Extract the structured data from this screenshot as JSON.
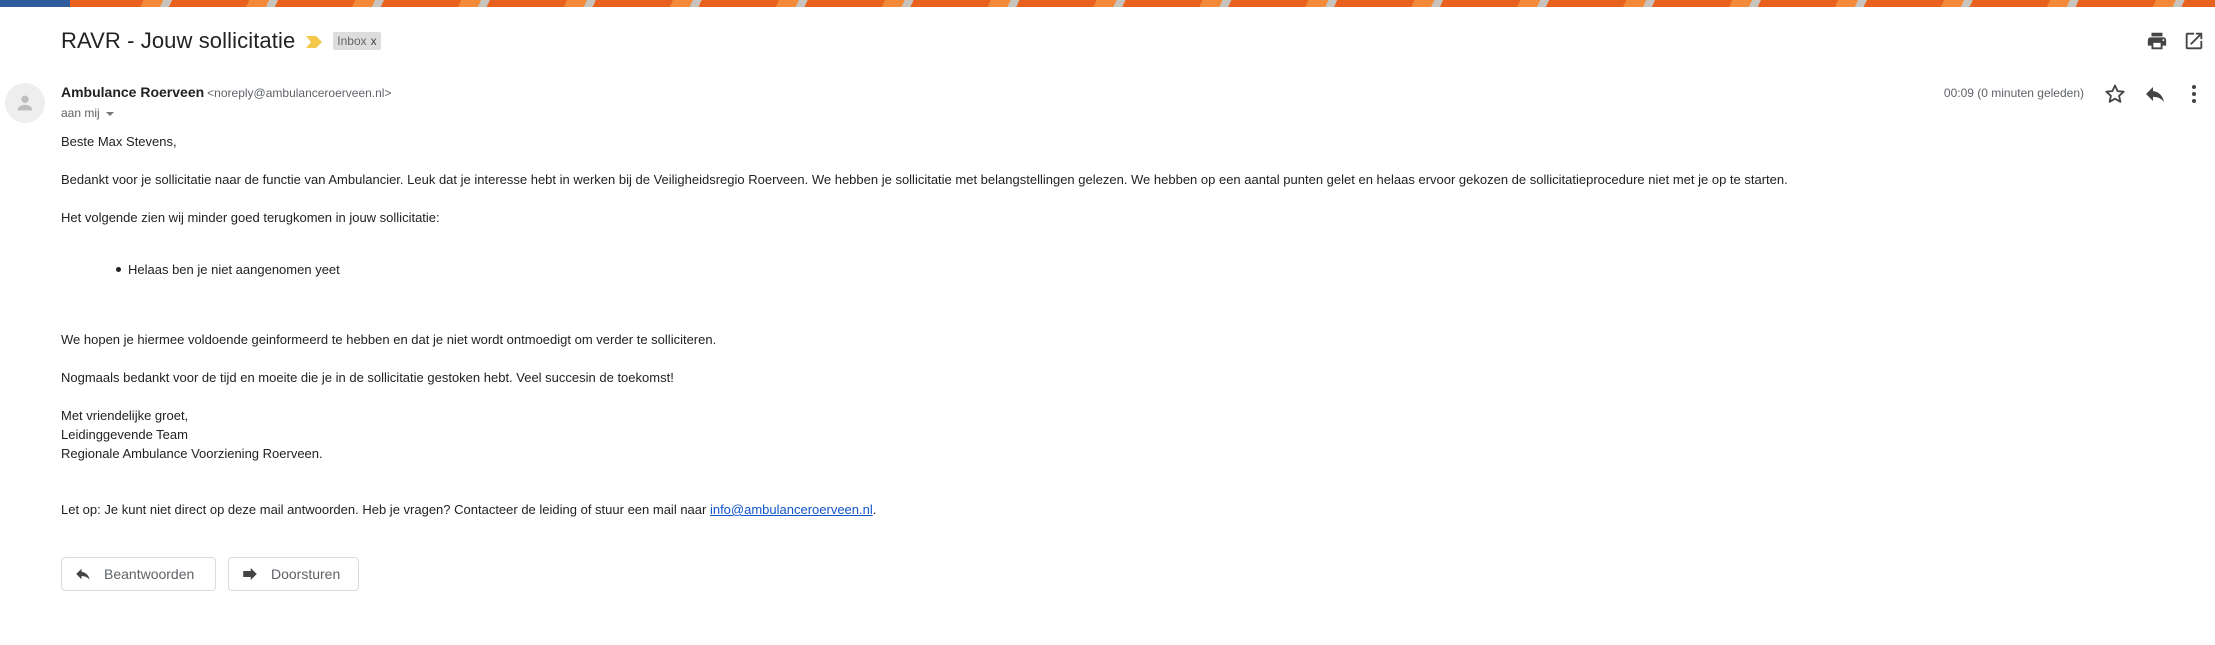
{
  "subject": "RAVR - Jouw sollicitatie",
  "label": {
    "text": "Inbox",
    "remove": "x"
  },
  "colors": {
    "importance": "#f2c94c",
    "link": "#1155cc",
    "banner_blue": "#2f5a9b",
    "banner_orange": "#e8611f"
  },
  "icons": {
    "print": "print-icon",
    "open_new_window": "open-in-new-window-icon",
    "star": "star-icon",
    "reply": "reply-icon",
    "more": "more-vertical-icon",
    "forward": "forward-icon",
    "avatar": "person-icon",
    "importance": "importance-marker-icon"
  },
  "sender": {
    "name": "Ambulance Roerveen",
    "email": "<noreply@ambulanceroerveen.nl>",
    "to": "aan mij",
    "time": "00:09 (0 minuten geleden)"
  },
  "body": {
    "greeting": "Beste Max Stevens,",
    "p1": "Bedankt voor je sollicitatie naar de functie van Ambulancier. Leuk dat je interesse hebt in werken bij de Veiligheidsregio Roerveen. We hebben je sollicitatie met belangstellingen gelezen. We hebben op een aantal punten gelet en helaas ervoor gekozen de sollicitatieprocedure niet met je op te starten.",
    "p2": "Het volgende zien wij minder goed terugkomen in jouw sollicitatie:",
    "bullets": [
      "Helaas ben je niet aangenomen yeet"
    ],
    "p3": "We hopen je hiermee voldoende geinformeerd te hebben en dat je niet wordt ontmoedigt om verder te solliciteren.",
    "p4": "Nogmaals bedankt voor de tijd en moeite die je in de sollicitatie gestoken hebt. Veel succesin de toekomst!",
    "closing": [
      "Met vriendelijke groet,",
      "Leidinggevende Team",
      "Regionale Ambulance Voorziening Roerveen."
    ],
    "note_prefix": "Let op: Je kunt niet direct op deze mail antwoorden. Heb je vragen? Contacteer de leiding of stuur een mail naar ",
    "note_link": "info@ambulanceroerveen.nl",
    "note_suffix": "."
  },
  "actions": {
    "reply": "Beantwoorden",
    "forward": "Doorsturen"
  }
}
